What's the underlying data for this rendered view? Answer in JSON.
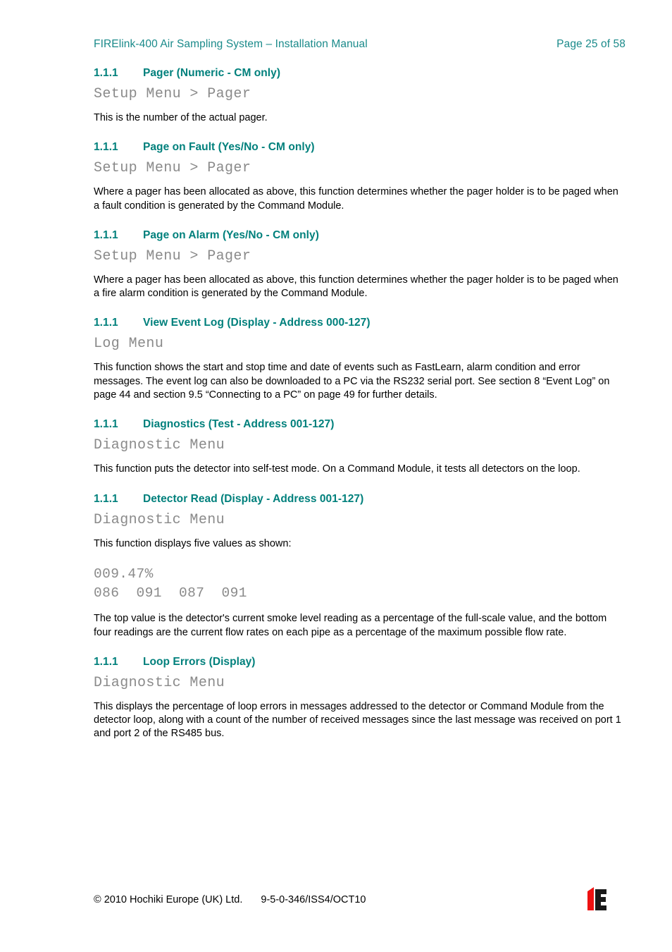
{
  "header": {
    "doc_title": "FIRElink-400 Air Sampling System – Installation Manual",
    "page_number": "Page 25 of 58"
  },
  "sections": [
    {
      "number": "1.1.1",
      "title": "Pager (Numeric - CM only)",
      "breadcrumb": "Setup Menu > Pager",
      "body": "This is the number of the actual pager."
    },
    {
      "number": "1.1.1",
      "title": "Page on Fault (Yes/No - CM only)",
      "breadcrumb": "Setup Menu > Pager",
      "body": "Where a pager has been allocated as above, this function determines whether the pager holder is to be paged when a fault condition is generated by the Command Module."
    },
    {
      "number": "1.1.1",
      "title": "Page on Alarm (Yes/No - CM only)",
      "breadcrumb": "Setup Menu > Pager",
      "body": "Where a pager has been allocated as above, this function determines whether the pager holder is to be paged when a fire alarm condition is generated by the Command Module."
    },
    {
      "number": "1.1.1",
      "title": "View Event Log (Display - Address 000-127)",
      "breadcrumb": "Log Menu",
      "body": "This function shows the start and stop time and date of events such as FastLearn, alarm condition and error messages.  The event log can also be downloaded to a PC via the RS232 serial port.  See section 8 “Event Log” on page 44 and section 9.5 “Connecting to a PC” on page 49 for further details."
    },
    {
      "number": "1.1.1",
      "title": "Diagnostics (Test - Address 001-127)",
      "breadcrumb": "Diagnostic Menu",
      "body": "This function puts the detector into self-test mode.  On a Command Module, it tests all detectors on the loop."
    },
    {
      "number": "1.1.1",
      "title": "Detector Read (Display - Address 001-127)",
      "breadcrumb": "Diagnostic Menu",
      "body": "This function displays five values as shown:",
      "display_readout": "009.47%\n086  091  087  091",
      "body2": "The top value is the detector's current smoke level reading as a percentage of the full-scale value, and the bottom four readings are the current flow rates on each pipe as a percentage of the maximum possible flow rate."
    },
    {
      "number": "1.1.1",
      "title": "Loop Errors (Display)",
      "breadcrumb": "Diagnostic Menu",
      "body": "This displays the percentage of loop errors in messages addressed to the detector or Command Module from the detector loop, along with a count of the number of received messages since the last message was received on port 1 and port 2 of the RS485 bus."
    }
  ],
  "readout_values": {
    "smoke_level": "009.47%",
    "flow_rates": [
      "086",
      "091",
      "087",
      "091"
    ]
  },
  "footer": {
    "copyright": "© 2010 Hochiki Europe (UK) Ltd.",
    "doc_code": "9-5-0-346/ISS4/OCT10",
    "logo_name": "hochiki-europe-logo"
  },
  "colors": {
    "heading_teal": "#00807c",
    "header_teal": "#1a8a8a",
    "mono_gray": "#8a8a8a",
    "logo_red": "#ee1111",
    "logo_black": "#1a1a1a"
  }
}
